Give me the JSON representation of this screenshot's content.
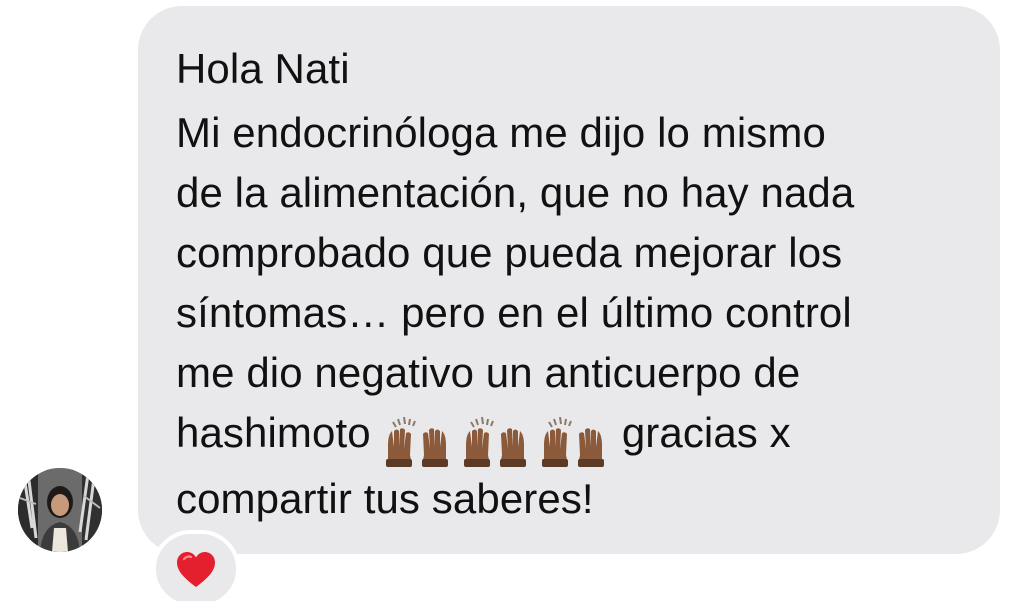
{
  "message": {
    "lines": [
      "Hola Nati",
      "Mi endocrinóloga me dijo lo mismo",
      "de la alimentación, que no hay nada",
      "comprobado que pueda mejorar los",
      "síntomas… pero en el último control",
      "me dio negativo un anticuerpo de"
    ],
    "line7_before": "hashimoto",
    "line7_emojis": "🙌🏾🙌🏾🙌🏾",
    "line7_after": "gracias x",
    "line8": "compartir tus saberes!"
  },
  "reaction": {
    "emoji": "❤️",
    "icon": "red-heart-icon",
    "color": "#e5202e"
  },
  "sender": {
    "avatar_icon": "profile-photo"
  },
  "colors": {
    "bubble": "#e9e9eb",
    "text": "#111111",
    "background": "#ffffff"
  }
}
